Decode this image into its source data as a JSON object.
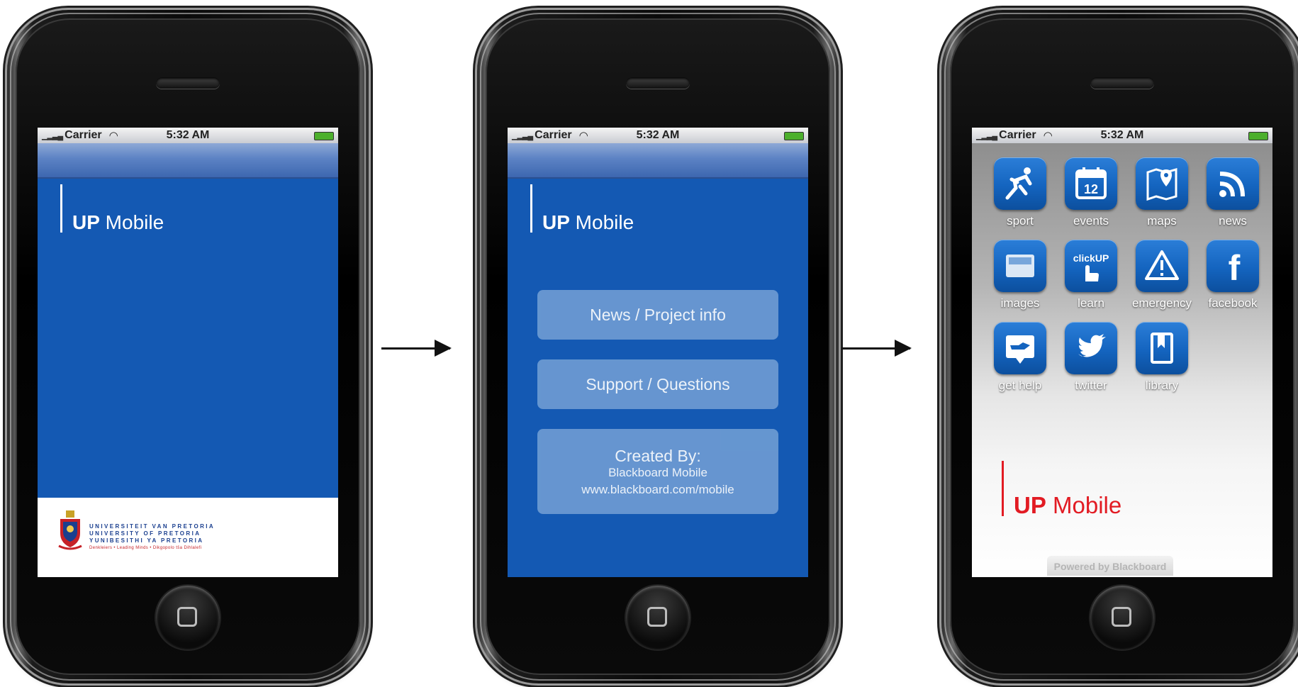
{
  "status_bar": {
    "carrier": "Carrier",
    "time": "5:32 AM"
  },
  "app_title": {
    "bold": "UP",
    "rest": " Mobile"
  },
  "screen1": {
    "university_lines": [
      "UNIVERSITEIT VAN PRETORIA",
      "UNIVERSITY OF PRETORIA",
      "YUNIBESITHI YA PRETORIA"
    ],
    "motto": "Denkleiers • Leading Minds • Dikgopolo tša Dihlalefi"
  },
  "screen2": {
    "button_news": "News / Project info",
    "button_support": "Support / Questions",
    "created_by_title": "Created By:",
    "created_by_name": "Blackboard Mobile",
    "created_by_url": "www.blackboard.com/mobile"
  },
  "screen3": {
    "apps": [
      {
        "label": "sport",
        "icon": "sport-runner-icon"
      },
      {
        "label": "events",
        "icon": "calendar-icon",
        "icon_text": "12"
      },
      {
        "label": "maps",
        "icon": "map-pin-icon"
      },
      {
        "label": "news",
        "icon": "rss-icon"
      },
      {
        "label": "images",
        "icon": "photos-icon"
      },
      {
        "label": "learn",
        "icon": "clickup-icon",
        "icon_text": "clickUP"
      },
      {
        "label": "emergency",
        "icon": "warning-icon"
      },
      {
        "label": "facebook",
        "icon": "facebook-icon",
        "icon_text": "f"
      },
      {
        "label": "get help",
        "icon": "help-hand-icon"
      },
      {
        "label": "twitter",
        "icon": "twitter-bird-icon"
      },
      {
        "label": "library",
        "icon": "book-icon"
      }
    ],
    "powered_by": "Powered by Blackboard"
  },
  "colors": {
    "screen_blue": "#1459b3",
    "button_blue": "#6d9bd3",
    "tile_blue": "#1464bf",
    "brand_red": "#e21b23",
    "university_blue": "#1a3f8f"
  }
}
